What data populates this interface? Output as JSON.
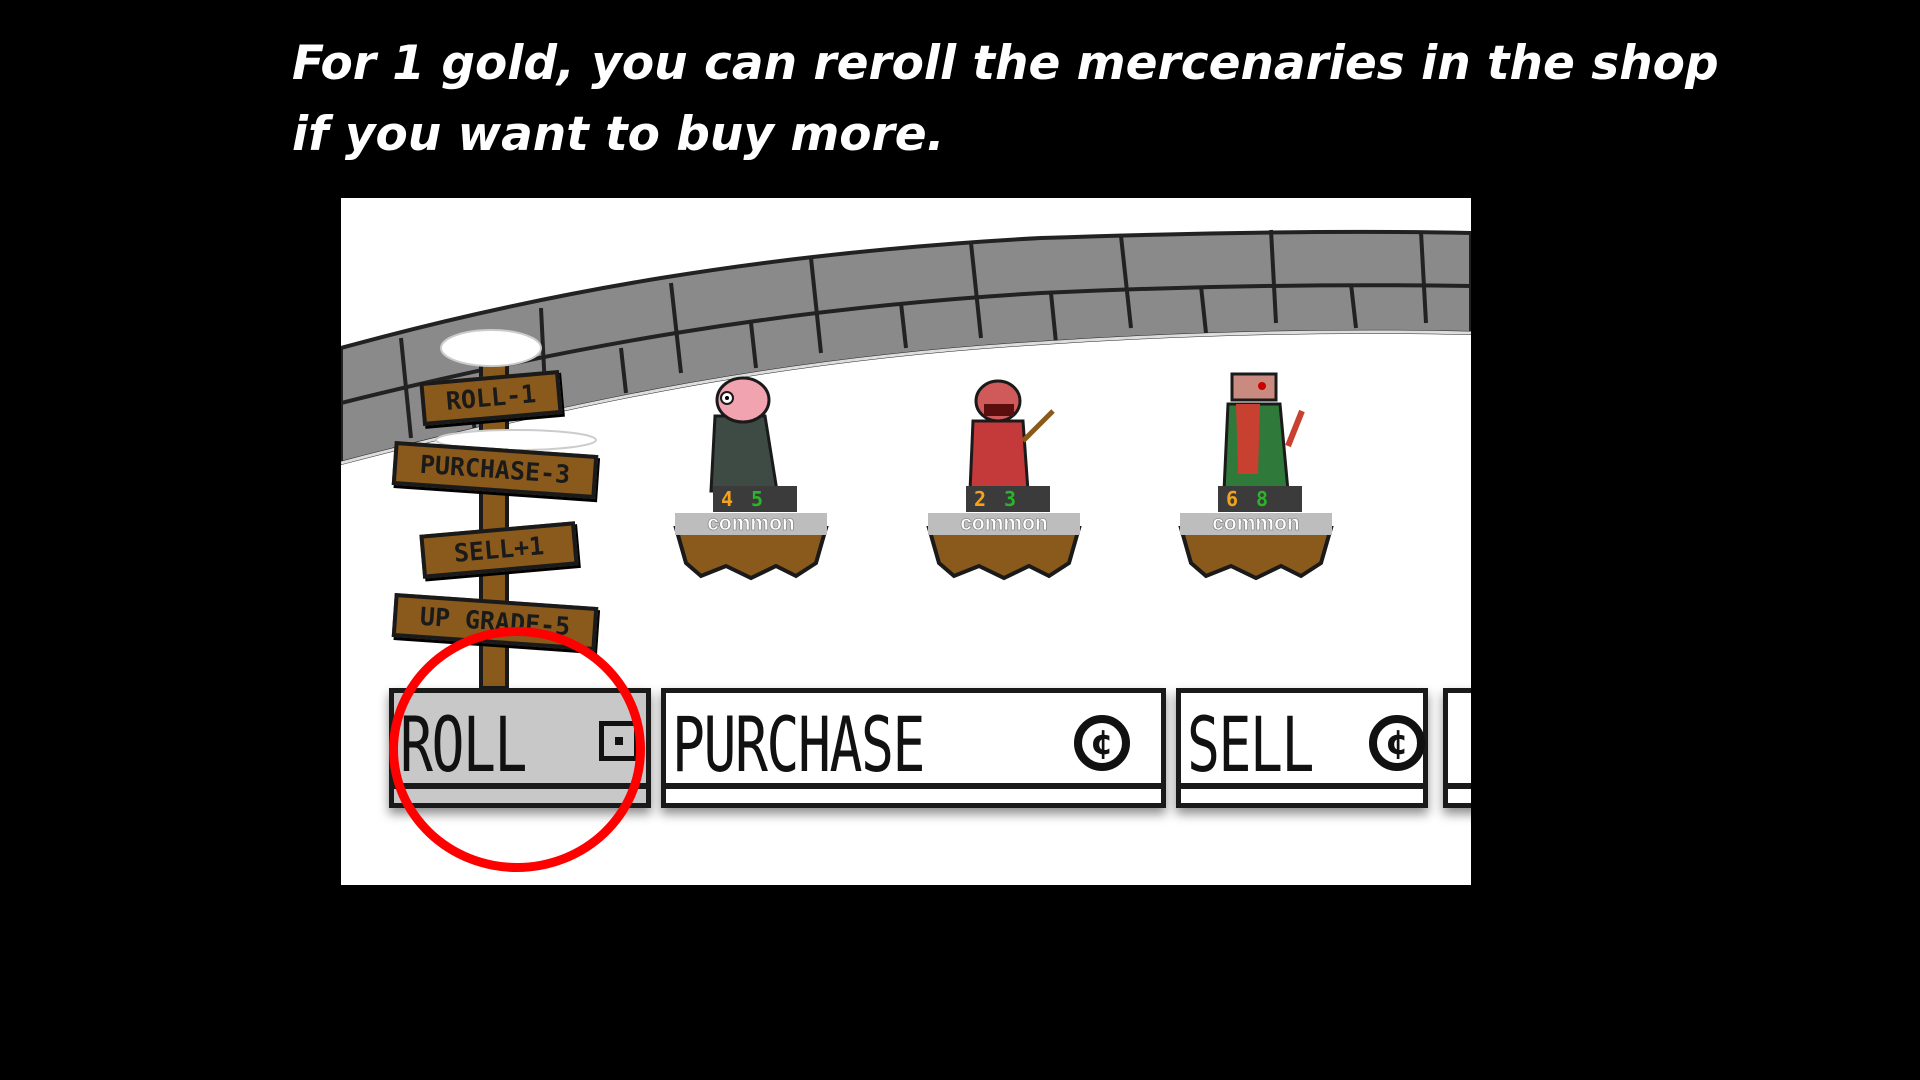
{
  "caption": {
    "line1": "For 1 gold, you can reroll the mercenaries in the shop",
    "line2": "if you want to buy more."
  },
  "signpost": {
    "roll": "ROLL-1",
    "purchase": "PURCHASE-3",
    "sell": "SELL+1",
    "upgrade": "UP GRADE-5"
  },
  "mercenaries": [
    {
      "attack": "4",
      "health": "5",
      "rarity": "common"
    },
    {
      "attack": "2",
      "health": "3",
      "rarity": "common"
    },
    {
      "attack": "6",
      "health": "8",
      "rarity": "common"
    }
  ],
  "buttons": {
    "roll": "ROLL",
    "purchase": "PURCHASE",
    "sell": "SELL",
    "coin_glyph": "¢"
  },
  "colors": {
    "highlight": "#ff0000",
    "attack": "#f3a21c",
    "health": "#2ab42a",
    "wood": "#8a5a1c",
    "stone": "#7d7d7d"
  }
}
